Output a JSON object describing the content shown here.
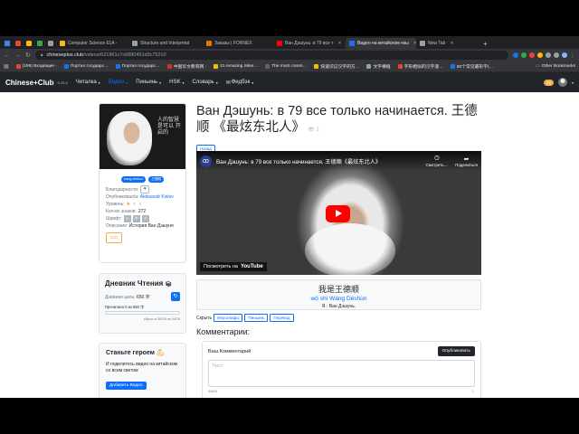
{
  "browser": {
    "tabs": [
      {
        "label": "",
        "color": "#4285f4"
      },
      {
        "label": "",
        "color": "#ea4335"
      },
      {
        "label": "",
        "color": "#5f6368"
      },
      {
        "label": "",
        "color": "#34a853"
      },
      {
        "label": "",
        "color": "#9aa0a6"
      },
      {
        "label": "Computer Science 61A -",
        "color": "#fbbc05"
      },
      {
        "label": "Structure and Interpretat",
        "color": "#9aa0a6"
      },
      {
        "label": "Заказы | FORNEX",
        "color": "#e8710a"
      },
      {
        "label": "Ван Дэшунь: в 79 все т",
        "color": "#ff0000"
      },
      {
        "label": "Видео на китайском язы",
        "color": "#1a73e8"
      },
      {
        "label": "New Tab",
        "color": "#9aa0a6"
      }
    ],
    "url_host": "chineseplus.club",
    "url_path": "/videos/621961c7c6880491d3c75210",
    "bookmarks": [
      {
        "label": "(199) Входящие -",
        "color": "#ea4335"
      },
      {
        "label": "Портал государс…",
        "color": "#1a73e8"
      },
      {
        "label": "Портал государс…",
        "color": "#1a73e8"
      },
      {
        "label": "中国华文教育网 -",
        "color": "#d93025"
      },
      {
        "label": "21 Amazing Sites…",
        "color": "#fbbc05"
      },
      {
        "label": "The most comm…",
        "color": "#5f6368"
      },
      {
        "label": "快速识记汉字的方…",
        "color": "#fbbc05"
      },
      {
        "label": "文字樽植",
        "color": "#9aa0a6"
      },
      {
        "label": "字形相似的汉字速…",
        "color": "#ea4335"
      },
      {
        "label": "80个常见最形字(…",
        "color": "#1a73e8"
      }
    ],
    "other_bookmarks": "Other Bookmarks"
  },
  "site": {
    "logo": "Chinese+Club",
    "logo_version": "0.29.6",
    "nav": [
      "Читалка",
      "Видео",
      "Пиньинь",
      "HSK",
      "Словарь",
      "Фидбэк"
    ],
    "coins": "25"
  },
  "profile": {
    "calligraphy": "人的智慧 是可以 开启的",
    "tags": [
      "wang deshun",
      "王德顺"
    ],
    "thanks_label": "Благодарности:",
    "published_label": "Опубликовал/а:",
    "publisher": "Aleksandr Kislov",
    "level_label": "Уровень:",
    "stars": 1,
    "stars_total": 3,
    "chars_label": "Кол-во знаков:",
    "chars": "272",
    "font_label": "Шрифт:",
    "font_options": [
      "小",
      "中",
      "大"
    ],
    "desc_label": "Описание:",
    "desc": "История Ван Дэшуня",
    "edit": "Edit"
  },
  "diary": {
    "title": "Дневник Чтения",
    "goal_label": "Дневная цель:",
    "goal": "650 字",
    "read_text": "Прочитано 0 из 650 字",
    "progress": 0,
    "reset": "сброс в 00:00 по МСК"
  },
  "hero": {
    "title": "Станьте героем",
    "text": "И поделитесь видео на китайском со всем светом",
    "button": "Добавить Видео"
  },
  "video": {
    "title": "Ван Дэшунь: в 79 все только начинается. 王德顺 《最炫东北人》",
    "views": "2",
    "back": "Назад",
    "player_title": "Ван Дэшунь: в 79 все только начинается. 王德顺《最炫东北人》",
    "watch_later": "Смотреть…",
    "share": "Поделиться",
    "watch_on": "Посмотреть на",
    "youtube": "YouTube"
  },
  "sentence": {
    "hanzi": "我是王德顺",
    "pinyin": "wǒ shì Wáng Déshùn",
    "translation": "Я - Ван Дэшунь."
  },
  "hide": {
    "label": "Скрыть",
    "buttons": [
      "Иероглифы",
      "Пиньинь",
      "Перевод"
    ]
  },
  "comments": {
    "title": "Комментарии:",
    "your_comment": "Ваш Комментарий",
    "publish": "Опубликовать",
    "placeholder": "Текст",
    "counter": "0/400"
  }
}
